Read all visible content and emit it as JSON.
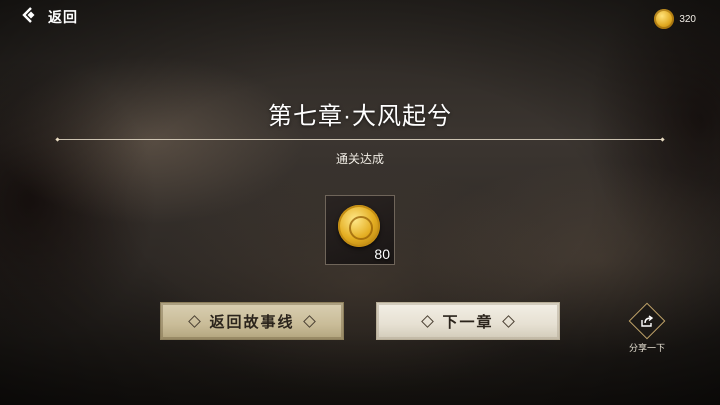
{
  "topbar": {
    "back_label": "返回",
    "currency_value": "320"
  },
  "chapter": {
    "title": "第七章·大风起兮",
    "status": "通关达成"
  },
  "reward": {
    "icon": "gold-coin-icon",
    "count": "80"
  },
  "buttons": {
    "story_label": "返回故事线",
    "next_label": "下一章"
  },
  "share": {
    "label": "分享一下"
  },
  "colors": {
    "gold": "#e4ae22",
    "button_story_bg": "#c9bc98",
    "button_next_bg": "#e6e0d2"
  }
}
